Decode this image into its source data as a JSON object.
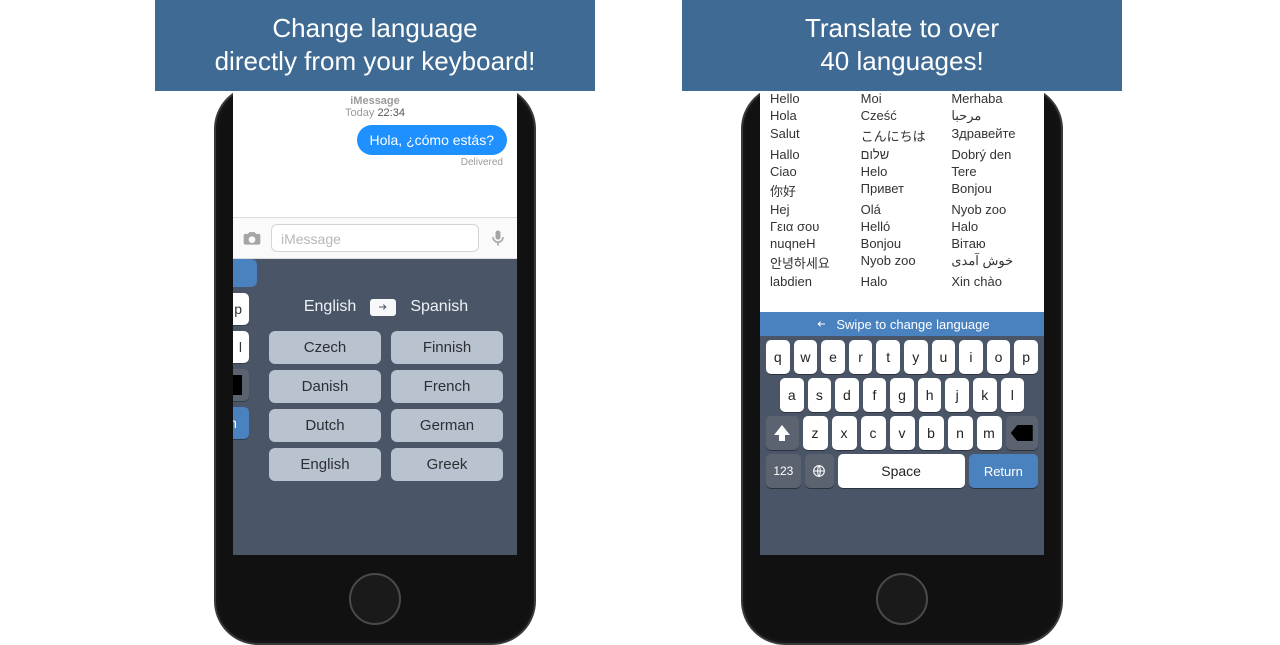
{
  "left": {
    "banner_line1": "Change language",
    "banner_line2": "directly from your keyboard!",
    "msg_app": "iMessage",
    "msg_day": "Today",
    "msg_time": "22:34",
    "bubble": "Hola, ¿cómo estás?",
    "delivered": "Delivered",
    "compose_placeholder": "iMessage",
    "edge_keys": [
      "p",
      "l"
    ],
    "return_label": "eturn",
    "lang_from": "English",
    "lang_to": "Spanish",
    "lang_col1": [
      "Czech",
      "Danish",
      "Dutch",
      "English"
    ],
    "lang_col2": [
      "Finnish",
      "French",
      "German",
      "Greek"
    ]
  },
  "right": {
    "banner_line1": "Translate to over",
    "banner_line2": "40 languages!",
    "greetings": [
      [
        "Hello",
        "Moi",
        "Merhaba"
      ],
      [
        "Hola",
        "Cześć",
        "مرحبا"
      ],
      [
        "Salut",
        "こんにちは",
        "Здравейте"
      ],
      [
        "Hallo",
        "שלום",
        "Dobrý den"
      ],
      [
        "Ciao",
        "Helo",
        "Tere"
      ],
      [
        "你好",
        "Привет",
        "Bonjou"
      ],
      [
        "Hej",
        "Olá",
        "Nyob zoo"
      ],
      [
        "Γεια σου",
        "Helló",
        "Halo"
      ],
      [
        "nuqneH",
        "Bonjou",
        "Вітаю"
      ],
      [
        "안녕하세요",
        "Nyob zoo",
        "خوش آمدی"
      ],
      [
        "labdien",
        "Halo",
        "Xin chào"
      ]
    ],
    "swipe_hint": "Swipe to change language",
    "row1": [
      "q",
      "w",
      "e",
      "r",
      "t",
      "y",
      "u",
      "i",
      "o",
      "p"
    ],
    "row2": [
      "a",
      "s",
      "d",
      "f",
      "g",
      "h",
      "j",
      "k",
      "l"
    ],
    "row3": [
      "z",
      "x",
      "c",
      "v",
      "b",
      "n",
      "m"
    ],
    "sym": "123",
    "space": "Space",
    "ret": "Return"
  }
}
